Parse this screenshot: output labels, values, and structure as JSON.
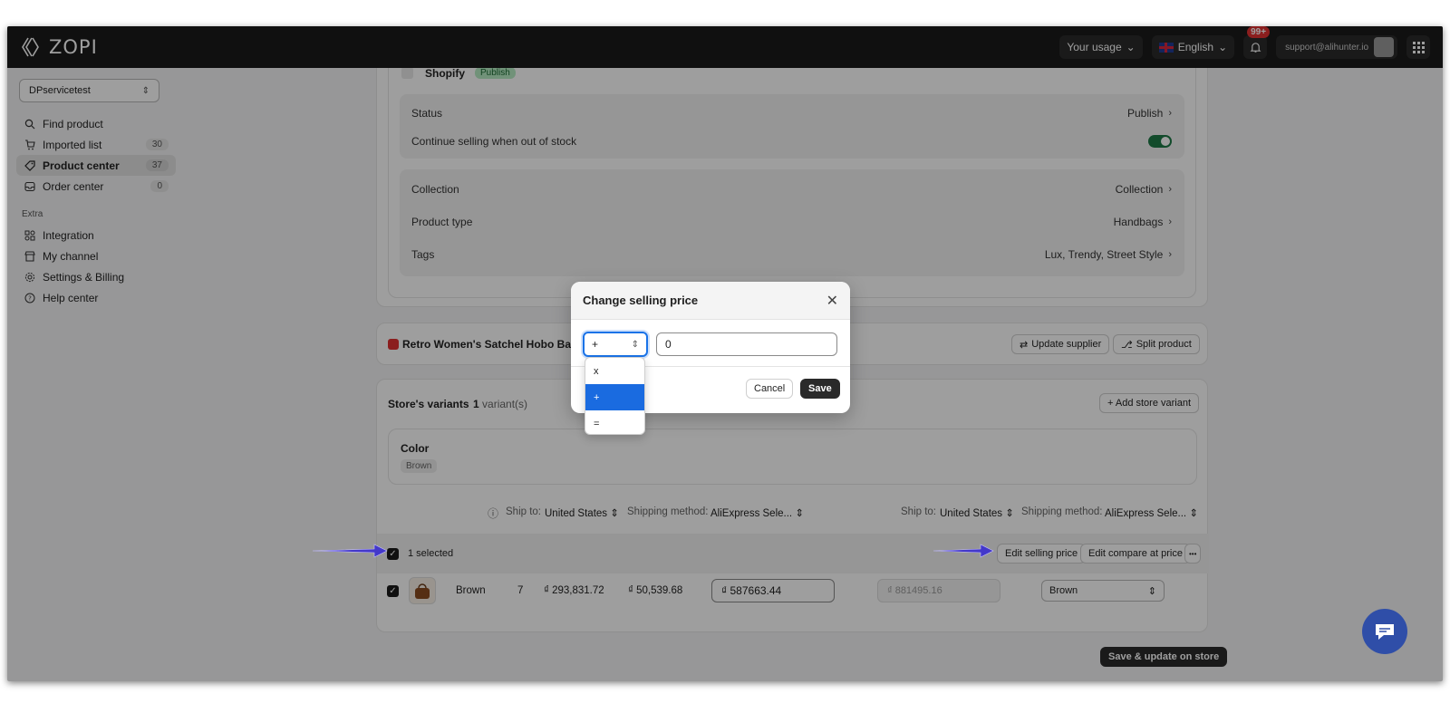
{
  "brand": {
    "name": "ZOPI"
  },
  "topbar": {
    "usage_label": "Your usage",
    "language_label": "English",
    "notification_count": "99+",
    "account_email": "support@alihunter.io"
  },
  "sidebar": {
    "store_name": "DPservicetest",
    "items": [
      {
        "label": "Find product",
        "count": ""
      },
      {
        "label": "Imported list",
        "count": "30"
      },
      {
        "label": "Product center",
        "count": "37"
      },
      {
        "label": "Order center",
        "count": "0"
      }
    ],
    "extra_title": "Extra",
    "extra_items": [
      {
        "label": "Integration"
      },
      {
        "label": "My channel"
      },
      {
        "label": "Settings & Billing"
      },
      {
        "label": "Help center"
      }
    ]
  },
  "channel": {
    "name": "Shopify",
    "badge": "Publish",
    "status_label": "Status",
    "status_value": "Publish",
    "continue_selling_label": "Continue selling when out of stock",
    "collection_label": "Collection",
    "collection_value": "Collection",
    "product_type_label": "Product type",
    "product_type_value": "Handbags",
    "tags_label": "Tags",
    "tags_value": "Lux, Trendy, Street Style"
  },
  "product": {
    "title": "Retro Women's Satchel Hobo Bag l",
    "update_supplier": "Update supplier",
    "split_product": "Split product"
  },
  "variants": {
    "title": "Store's variants",
    "count": "1",
    "count_label": "variant(s)",
    "add_button": "+ Add store variant",
    "option_name": "Color",
    "option_value": "Brown",
    "ship_to_label": "Ship to:",
    "ship_to_value": "United States",
    "shipping_method_label": "Shipping method:",
    "shipping_method_value": "AliExpress Sele...",
    "selected_text": "1 selected",
    "edit_selling": "Edit selling price",
    "edit_compare": "Edit compare at price",
    "more": "•••",
    "row": {
      "name": "Brown",
      "stock": "7",
      "cost": "₫ 293,831.72",
      "shipping": "₫ 50,539.68",
      "selling_price": "₫  587663.44",
      "compare_price": "₫  881495.16",
      "option": "Brown"
    },
    "save_update": "Save & update on store"
  },
  "modal": {
    "title": "Change selling price",
    "operator": "+",
    "amount": "0",
    "cancel": "Cancel",
    "save": "Save",
    "options": [
      "x",
      "+",
      "="
    ]
  },
  "colors": {
    "topbar": "#1a1a1a",
    "accent_blue": "#1a6be0",
    "toggle_green": "#1e7a46",
    "annotation_arrow": "#4338ca",
    "chat": "#2f4ea8"
  }
}
